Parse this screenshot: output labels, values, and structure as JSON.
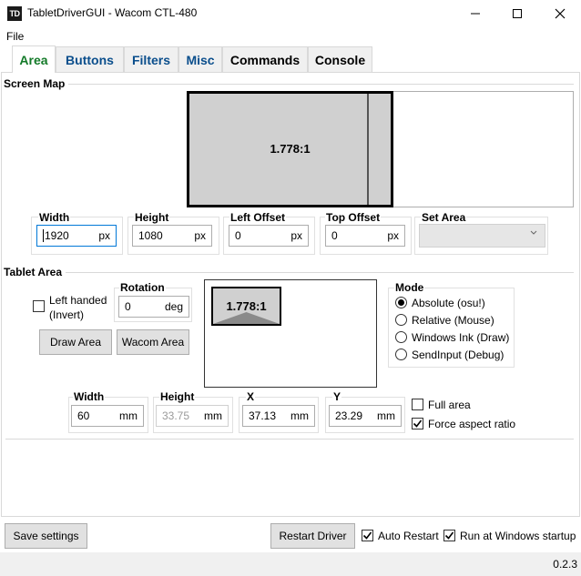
{
  "window": {
    "icon_text": "TD",
    "title": "TabletDriverGUI - Wacom CTL-480"
  },
  "menu": {
    "file": "File"
  },
  "tabs": [
    {
      "label": "Area",
      "active": true
    },
    {
      "label": "Buttons"
    },
    {
      "label": "Filters"
    },
    {
      "label": "Misc"
    },
    {
      "label": "Commands"
    },
    {
      "label": "Console"
    }
  ],
  "screen_map": {
    "title": "Screen Map",
    "ratio": "1.778:1",
    "fields": [
      {
        "label": "Width",
        "value": "1920",
        "unit": "px"
      },
      {
        "label": "Height",
        "value": "1080",
        "unit": "px"
      },
      {
        "label": "Left Offset",
        "value": "0",
        "unit": "px"
      },
      {
        "label": "Top Offset",
        "value": "0",
        "unit": "px"
      }
    ],
    "set_area": {
      "label": "Set Area",
      "value": ""
    }
  },
  "tablet_area": {
    "title": "Tablet Area",
    "left_handed": "Left handed\n(Invert)",
    "left_handed_line1": "Left handed",
    "left_handed_line2": "(Invert)",
    "rotation": {
      "label": "Rotation",
      "value": "0",
      "unit": "deg"
    },
    "draw_area": "Draw Area",
    "wacom_area": "Wacom Area",
    "ratio": "1.778:1",
    "mode": {
      "title": "Mode",
      "options": [
        {
          "label": "Absolute (osu!)",
          "selected": true
        },
        {
          "label": "Relative (Mouse)",
          "selected": false
        },
        {
          "label": "Windows Ink (Draw)",
          "selected": false
        },
        {
          "label": "SendInput (Debug)",
          "selected": false
        }
      ]
    },
    "fields": [
      {
        "label": "Width",
        "value": "60",
        "unit": "mm"
      },
      {
        "label": "Height",
        "value": "33.75",
        "unit": "mm"
      },
      {
        "label": "X",
        "value": "37.13",
        "unit": "mm"
      },
      {
        "label": "Y",
        "value": "23.29",
        "unit": "mm"
      }
    ],
    "full_area": {
      "label": "Full area",
      "checked": false
    },
    "force_aspect": {
      "label": "Force aspect ratio",
      "checked": true
    }
  },
  "bottom": {
    "save_settings": "Save settings",
    "restart_driver": "Restart Driver",
    "auto_restart": {
      "label": "Auto Restart",
      "checked": true
    },
    "run_at_startup": {
      "label": "Run at Windows startup",
      "checked": true
    }
  },
  "status": {
    "version": "0.2.3"
  },
  "colors": {
    "active_tab_text": "#137a28",
    "tab_text": "#0a4e8c",
    "focus_border": "#0078d7",
    "map_fill": "#d0d0d0"
  }
}
